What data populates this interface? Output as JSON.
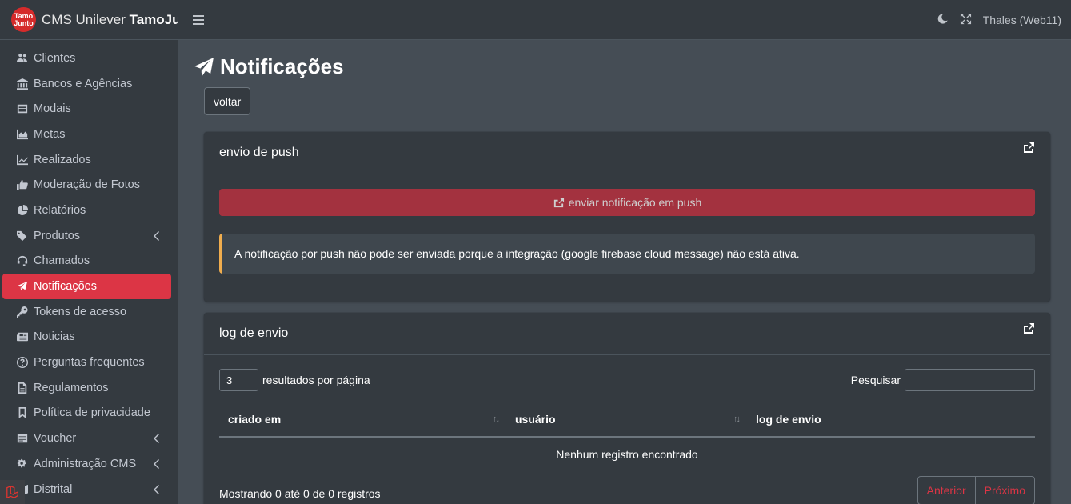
{
  "brand": {
    "logo_line1": "Tamo",
    "logo_line2": "Junto",
    "name_prefix": "CMS Unilever ",
    "name_bold": "TamoJunto"
  },
  "sidebar": {
    "items": [
      {
        "label": "Clientes",
        "icon": "users-icon"
      },
      {
        "label": "Bancos e Agências",
        "icon": "bank-icon"
      },
      {
        "label": "Modais",
        "icon": "modal-icon"
      },
      {
        "label": "Metas",
        "icon": "chart-area-icon"
      },
      {
        "label": "Realizados",
        "icon": "chart-line-icon"
      },
      {
        "label": "Moderação de Fotos",
        "icon": "thumbs-up-icon"
      },
      {
        "label": "Relatórios",
        "icon": "pie-chart-icon"
      },
      {
        "label": "Produtos",
        "icon": "tags-icon",
        "has_children": true
      },
      {
        "label": "Chamados",
        "icon": "headset-icon"
      },
      {
        "label": "Notificações",
        "icon": "paper-plane-icon",
        "active": true
      },
      {
        "label": "Tokens de acesso",
        "icon": "key-icon"
      },
      {
        "label": "Noticias",
        "icon": "newspaper-icon"
      },
      {
        "label": "Perguntas frequentes",
        "icon": "question-circle-icon"
      },
      {
        "label": "Regulamentos",
        "icon": "file-icon"
      },
      {
        "label": "Política de privacidade",
        "icon": "bookmark-icon"
      },
      {
        "label": "Voucher",
        "icon": "voucher-icon",
        "has_children": true
      },
      {
        "label": "Administração CMS",
        "icon": "cogs-icon",
        "has_children": true
      },
      {
        "label": "Distrital",
        "icon": "map-icon",
        "has_children": true
      }
    ]
  },
  "topbar": {
    "user": "Thales (Web11)"
  },
  "page": {
    "title": "Notificações",
    "back_label": "voltar"
  },
  "push_card": {
    "title": "envio de push",
    "button_label": "enviar notificação em push",
    "alert": "A notificação por push não pode ser enviada porque a integração (google firebase cloud message) não está ativa."
  },
  "log_card": {
    "title": "log de envio",
    "length_value": "3",
    "length_label": "resultados por página",
    "search_label": "Pesquisar",
    "columns": [
      "criado em",
      "usuário",
      "log de envio"
    ],
    "empty": "Nenhum registro encontrado",
    "info": "Mostrando 0 até 0 de 0 registros",
    "prev": "Anterior",
    "next": "Próximo"
  },
  "colors": {
    "accent": "#dc3545",
    "sidebar_bg": "#343a40",
    "content_bg": "#454d55",
    "alert_border": "#f0ad4e"
  }
}
